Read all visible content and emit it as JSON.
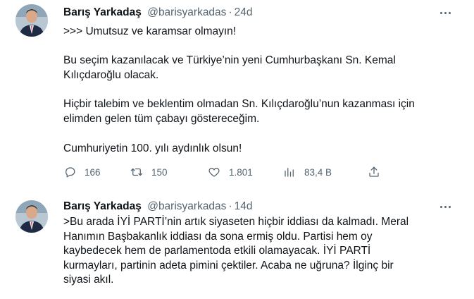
{
  "tweets": [
    {
      "author_name": "Barış Yarkadaş",
      "handle": "@barisyarkadas",
      "separator": "·",
      "time": "24d",
      "paragraphs": [
        ">>> Umutsuz ve karamsar olmayın!",
        "Bu seçim kazanılacak ve Türkiye’nin yeni Cumhurbaşkanı Sn. Kemal\nKılıçdaroğlu olacak.",
        "Hiçbir talebim ve beklentim olmadan Sn. Kılıçdaroğlu’nun kazanması için\nelimden gelen tüm çabayı göstereceğim.",
        "Cumhuriyetin 100. yılı aydınlık olsun!"
      ],
      "stats": {
        "replies": "166",
        "retweets": "150",
        "likes": "1.801",
        "views": "83,4 B"
      }
    },
    {
      "author_name": "Barış Yarkadaş",
      "handle": "@barisyarkadas",
      "separator": "·",
      "time": "14d",
      "paragraphs": [
        ">Bu arada İYİ PARTİ’nin artık siyaseten hiçbir iddiası da kalmadı. Meral\nHanımın Başbakanlık iddiası da sona ermiş oldu. Partisi hem oy\nkaybedecek hem de parlamentoda etkili olamayacak. İYİ PARTİ\nkurmayları, partinin adeta pimini çektiler. Acaba ne uğruna? İlginç bir\nsiyasi akıl."
      ]
    }
  ],
  "icons": {
    "reply": "reply-icon",
    "retweet": "retweet-icon",
    "like": "heart-icon",
    "views": "views-chart-icon",
    "share": "share-icon",
    "more": "more-dots-icon"
  },
  "colors": {
    "text": "#0f1419",
    "secondary": "#536471",
    "divider": "#eff3f4"
  }
}
